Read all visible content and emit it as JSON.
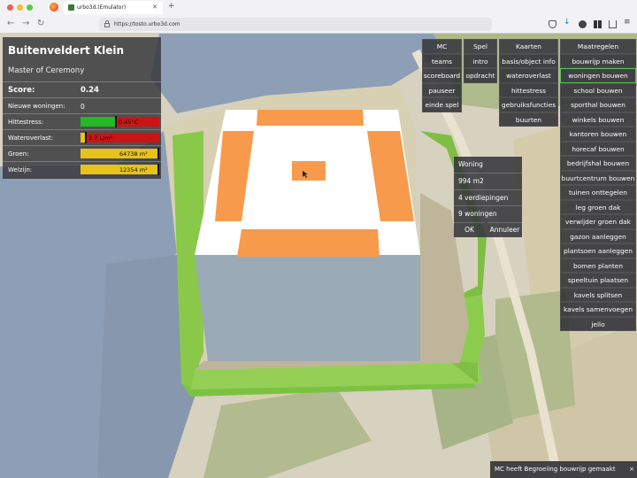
{
  "browser": {
    "tab_title": "urbo3d.(Emulator)",
    "tab_close": "✕",
    "new_tab": "+",
    "back": "←",
    "forward": "→",
    "reload": "↻",
    "url": "https://tosto.urbo3d.com",
    "download": "↓",
    "menu": "≡"
  },
  "info_panel": {
    "title": "Buitenveldert Klein",
    "role": "Master of Ceremony",
    "score_label": "Score:",
    "score_value": "0.24",
    "new_homes_label": "Nieuwe woningen:",
    "new_homes_value": "0",
    "indicators": [
      {
        "label": "Hittestress:",
        "text": "0.45°C",
        "level": 0.44,
        "fill_color": "#22bb22"
      },
      {
        "label": "Wateroverlast:",
        "text": "2.7 L/m²",
        "level": 0.06,
        "fill_color": "#e8c21a"
      },
      {
        "label": "Groen:",
        "text": "64738 m²",
        "level": 0.98,
        "fill_color": "#e8c21a"
      },
      {
        "label": "Welzijn:",
        "text": "12354 m²",
        "level": 0.98,
        "fill_color": "#e8c21a"
      }
    ]
  },
  "menu": {
    "columns": [
      {
        "head": "MC",
        "items": [
          "teams",
          "scoreboard",
          "pauseer",
          "einde spel"
        ]
      },
      {
        "head": "Spel",
        "items": [
          "intro",
          "opdracht"
        ]
      },
      {
        "head": "Kaarten",
        "items": [
          "basis/object info",
          "wateroverlast",
          "hittestress",
          "gebruiksfuncties",
          "buurten"
        ]
      },
      {
        "head": "Maatregelen",
        "items": [
          "bouwrijp maken",
          "woningen bouwen",
          "school bouwen",
          "sporthal bouwen",
          "winkels bouwen",
          "kantoren bouwen",
          "horecaf bouwen",
          "bedrijfshal bouwen",
          "buurtcentrum bouwen",
          "tuinen onttegelen",
          "leg groen dak",
          "verwijder groen dak",
          "gazon aanleggen",
          "plantsoen aanleggen",
          "bomen planten",
          "speeltuin plaatsen",
          "kavels splitsen",
          "kavels samenvoegen",
          "jello"
        ]
      }
    ],
    "active_item": "woningen bouwen"
  },
  "popup": {
    "title": "Woning",
    "area": "994 m2",
    "floors": "4 verdiepingen",
    "homes": "9 woningen",
    "ok": "OK",
    "cancel": "Annuleer"
  },
  "notification": {
    "text": "MC heeft Begroeiing bouwrijp gemaakt",
    "close": "×"
  },
  "colors": {
    "grass": "#7cc242",
    "roof_orange": "#f79a4c",
    "building_wall": "#9aa9b6",
    "panel_bg": "#3a3a3e"
  }
}
